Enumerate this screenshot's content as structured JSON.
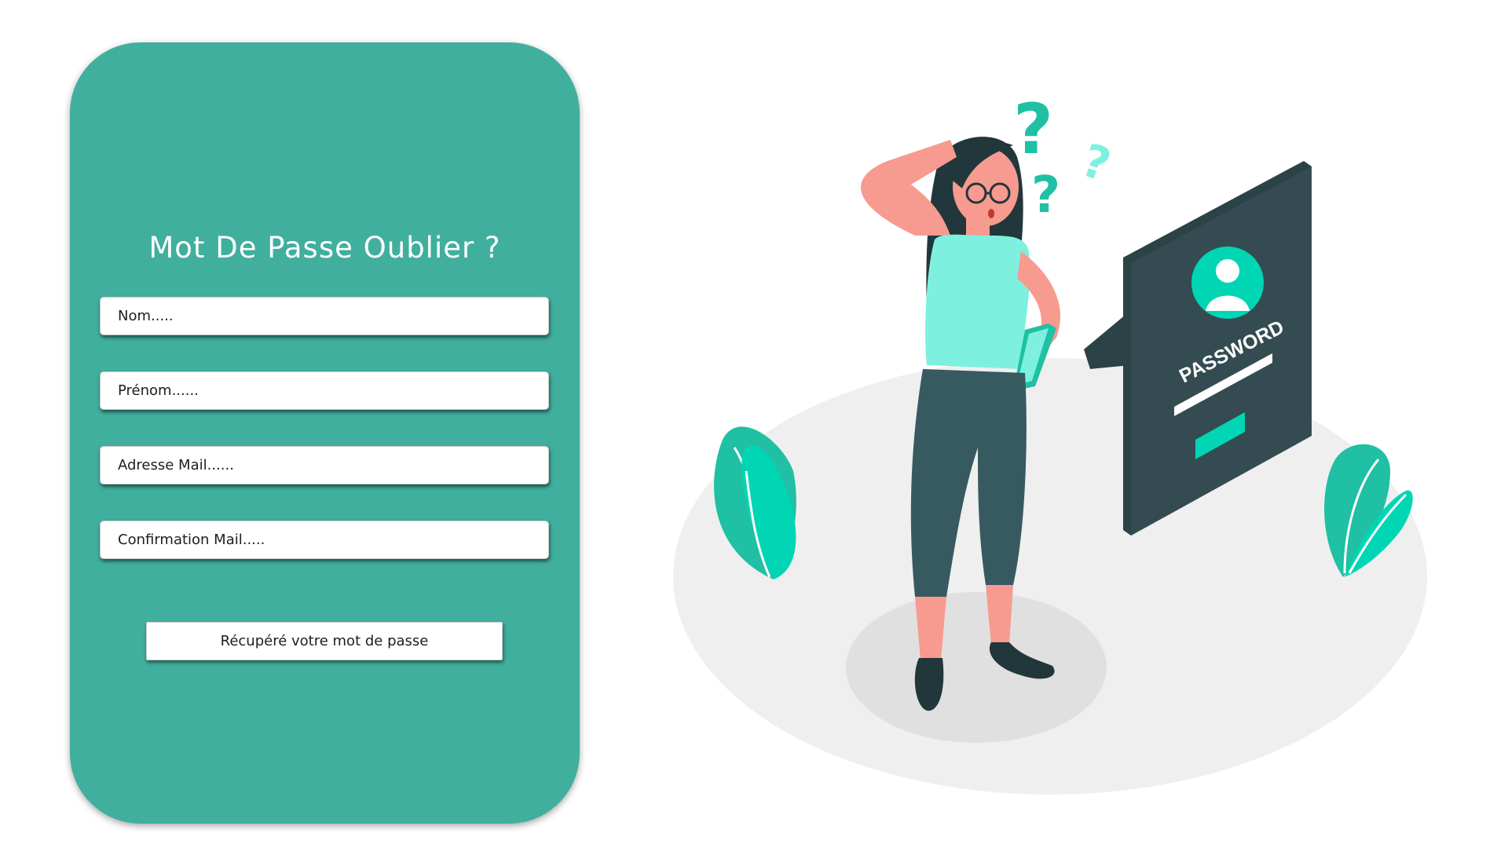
{
  "form": {
    "title": "Mot De Passe Oublier ?",
    "fields": [
      {
        "placeholder": "Nom....."
      },
      {
        "placeholder": "Prénom......"
      },
      {
        "placeholder": "Adresse Mail......"
      },
      {
        "placeholder": "Confirmation Mail....."
      }
    ],
    "submit_label": "Récupéré votre mot de passe"
  },
  "illustration": {
    "screen_label": "PASSWORD",
    "question_marks": [
      "?",
      "?",
      "?"
    ]
  },
  "colors": {
    "card_bg": "#40af9e",
    "accent": "#00d6b4",
    "dark": "#2e474c",
    "floor": "#efefef"
  }
}
